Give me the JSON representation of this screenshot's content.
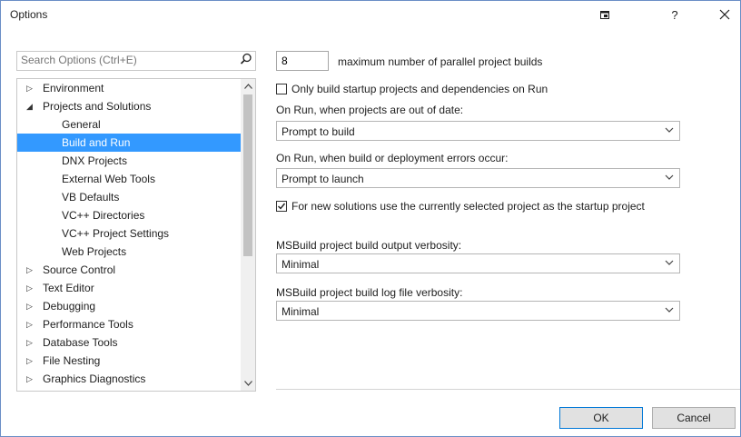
{
  "window": {
    "title": "Options",
    "pin_icon": "pin-icon",
    "help_label": "?",
    "close_label": "✕"
  },
  "search": {
    "placeholder": "Search Options (Ctrl+E)",
    "icon": "search-icon"
  },
  "tree": {
    "items": [
      {
        "label": "Environment",
        "level": 0,
        "expanded": false
      },
      {
        "label": "Projects and Solutions",
        "level": 0,
        "expanded": true
      },
      {
        "label": "General",
        "level": 1
      },
      {
        "label": "Build and Run",
        "level": 1,
        "selected": true
      },
      {
        "label": "DNX Projects",
        "level": 1
      },
      {
        "label": "External Web Tools",
        "level": 1
      },
      {
        "label": "VB Defaults",
        "level": 1
      },
      {
        "label": "VC++ Directories",
        "level": 1
      },
      {
        "label": "VC++ Project Settings",
        "level": 1
      },
      {
        "label": "Web Projects",
        "level": 1
      },
      {
        "label": "Source Control",
        "level": 0,
        "expanded": false
      },
      {
        "label": "Text Editor",
        "level": 0,
        "expanded": false
      },
      {
        "label": "Debugging",
        "level": 0,
        "expanded": false
      },
      {
        "label": "Performance Tools",
        "level": 0,
        "expanded": false
      },
      {
        "label": "Database Tools",
        "level": 0,
        "expanded": false
      },
      {
        "label": "File Nesting",
        "level": 0,
        "expanded": false
      },
      {
        "label": "Graphics Diagnostics",
        "level": 0,
        "expanded": false
      }
    ],
    "scroll_position": 0.0
  },
  "settings": {
    "parallel_builds_value": "8",
    "parallel_builds_label": "maximum number of parallel project builds",
    "startup_only_label": "Only build startup projects and dependencies on Run",
    "startup_only_checked": false,
    "out_of_date_label": "On Run, when projects are out of date:",
    "out_of_date_value": "Prompt to build",
    "build_errors_label": "On Run, when build or deployment errors occur:",
    "build_errors_value": "Prompt to launch",
    "new_solutions_label": "For new solutions use the currently selected project as the startup project",
    "new_solutions_checked": true,
    "output_verbosity_label": "MSBuild project build output verbosity:",
    "output_verbosity_value": "Minimal",
    "log_verbosity_label": "MSBuild project build log file verbosity:",
    "log_verbosity_value": "Minimal"
  },
  "footer": {
    "ok_label": "OK",
    "cancel_label": "Cancel"
  }
}
